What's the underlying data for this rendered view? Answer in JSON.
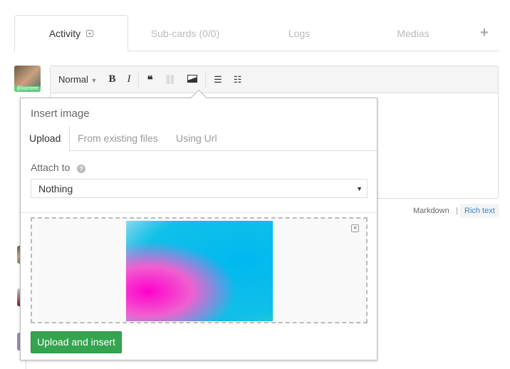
{
  "tabs": {
    "activity": "Activity",
    "subcards": "Sub-cards (0/0)",
    "logs": "Logs",
    "medias": "Medias",
    "add": "+"
  },
  "user": {
    "handle": "@kantree"
  },
  "toolbar": {
    "format": "Normal",
    "bold": "B",
    "italic": "I",
    "quote": "❝",
    "link": "⛓",
    "image": "image-icon",
    "bullet": "☰",
    "numbered": "☷"
  },
  "popup": {
    "title": "Insert image",
    "tabs": [
      "Upload",
      "From existing files",
      "Using Url"
    ],
    "attach_label": "Attach to",
    "attach_value": "Nothing",
    "submit": "Upload and insert"
  },
  "editor_modes": {
    "markdown": "Markdown",
    "separator": "|",
    "rich": "Rich text"
  },
  "colors": {
    "accent": "#34a44f",
    "link": "#3a7fd0"
  }
}
